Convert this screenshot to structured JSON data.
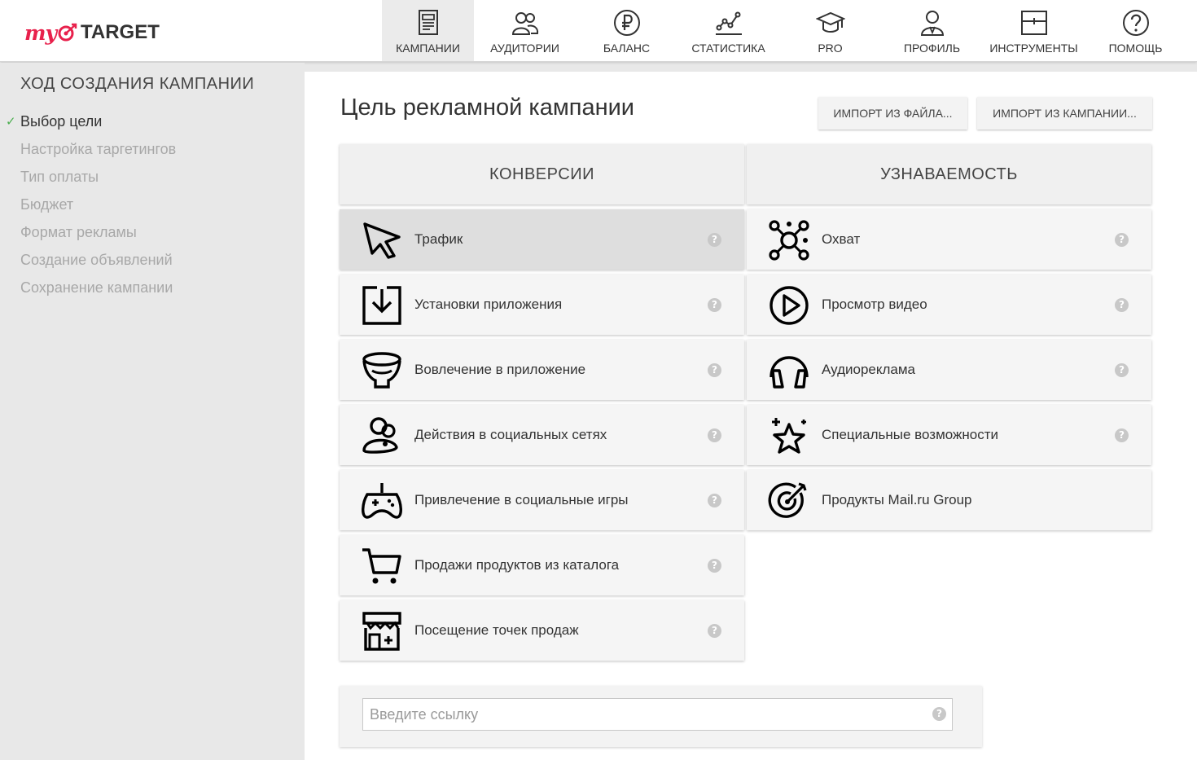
{
  "brand": {
    "my": "my",
    "target": "TARGET",
    "accent": "#e8214c"
  },
  "nav": [
    {
      "id": "campaigns",
      "label": "КАМПАНИИ",
      "icon": "document-icon",
      "active": true
    },
    {
      "id": "audiences",
      "label": "АУДИТОРИИ",
      "icon": "users-icon"
    },
    {
      "id": "balance",
      "label": "БАЛАНС",
      "icon": "ruble-icon"
    },
    {
      "id": "stats",
      "label": "СТАТИСТИКА",
      "icon": "line-chart-icon"
    },
    {
      "id": "pro",
      "label": "PRO",
      "icon": "graduation-cap-icon"
    },
    {
      "id": "profile",
      "label": "ПРОФИЛЬ",
      "icon": "person-icon"
    },
    {
      "id": "tools",
      "label": "ИНСТРУМЕНТЫ",
      "icon": "toolbox-icon"
    },
    {
      "id": "help",
      "label": "ПОМОЩЬ",
      "icon": "question-icon"
    }
  ],
  "sidebar": {
    "title": "ХОД СОЗДАНИЯ КАМПАНИИ",
    "steps": [
      {
        "label": "Выбор цели",
        "done": true
      },
      {
        "label": "Настройка таргетингов"
      },
      {
        "label": "Тип оплаты"
      },
      {
        "label": "Бюджет"
      },
      {
        "label": "Формат рекламы"
      },
      {
        "label": "Создание объявлений"
      },
      {
        "label": "Сохранение кампании"
      }
    ]
  },
  "main": {
    "title": "Цель рекламной кампании",
    "import_file": "ИМПОРТ ИЗ ФАЙЛА...",
    "import_campaign": "ИМПОРТ ИЗ КАМПАНИИ...",
    "conversions": {
      "header": "КОНВЕРСИИ",
      "items": [
        {
          "label": "Трафик",
          "icon": "cursor-icon",
          "selected": true
        },
        {
          "label": "Установки приложения",
          "icon": "download-box-icon"
        },
        {
          "label": "Вовлечение в приложение",
          "icon": "funnel-icon"
        },
        {
          "label": "Действия в социальных сетях",
          "icon": "social-icon"
        },
        {
          "label": "Привлечение в социальные игры",
          "icon": "gamepad-icon"
        },
        {
          "label": "Продажи продуктов из каталога",
          "icon": "cart-icon"
        },
        {
          "label": "Посещение точек продаж",
          "icon": "store-icon"
        }
      ]
    },
    "awareness": {
      "header": "УЗНАВАЕМОСТЬ",
      "items": [
        {
          "label": "Охват",
          "icon": "reach-icon"
        },
        {
          "label": "Просмотр видео",
          "icon": "play-icon"
        },
        {
          "label": "Аудиореклама",
          "icon": "headphones-icon"
        },
        {
          "label": "Специальные возможности",
          "icon": "star-icon"
        },
        {
          "label": "Продукты Mail.ru Group",
          "icon": "target-icon",
          "no_help": true
        }
      ]
    },
    "help_glyph": "?",
    "url": {
      "placeholder": "Введите ссылку",
      "value": ""
    }
  }
}
